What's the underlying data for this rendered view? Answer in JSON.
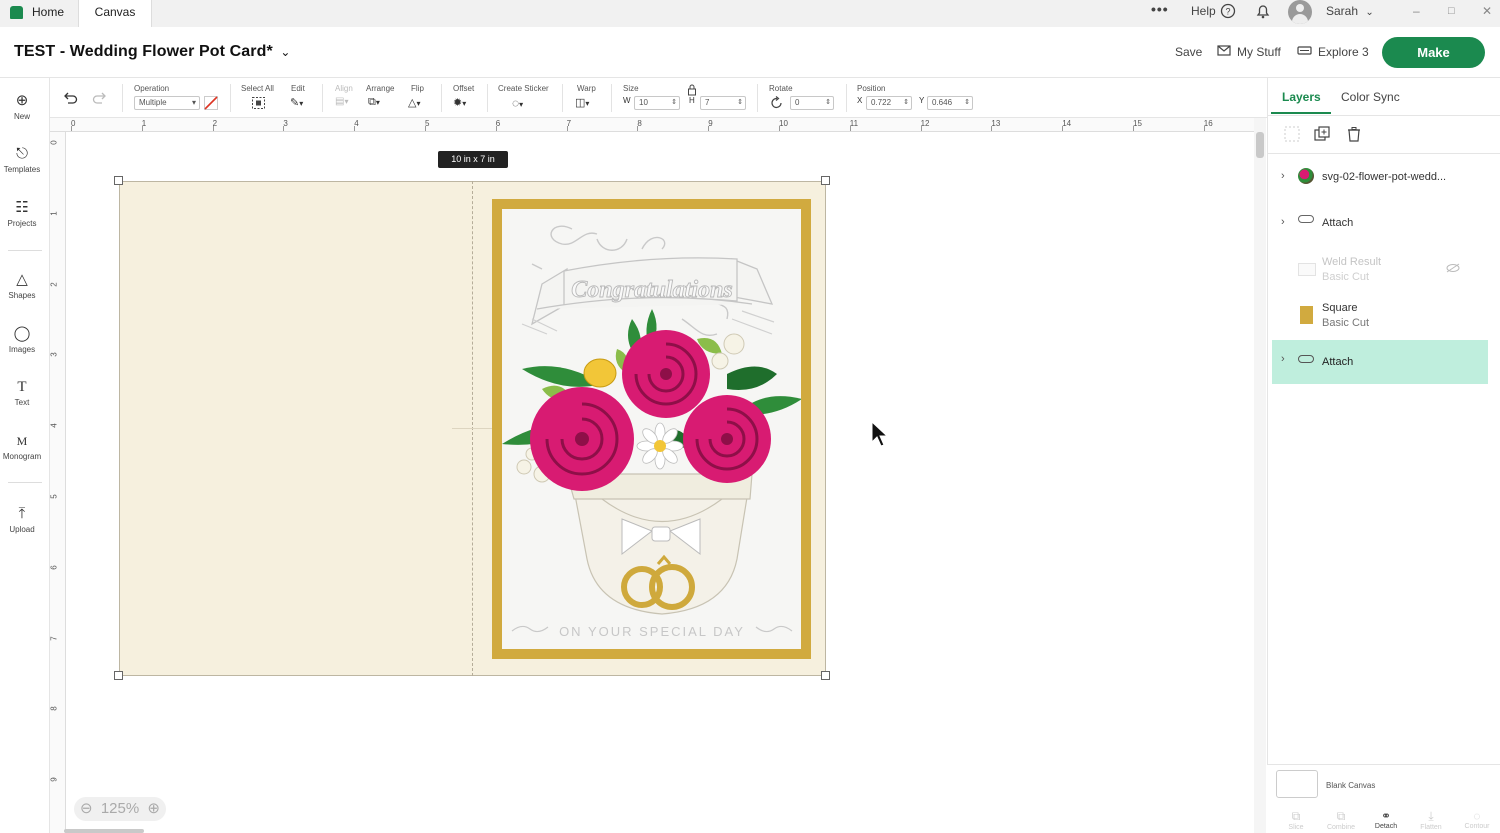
{
  "tabs": {
    "home": "Home",
    "canvas": "Canvas"
  },
  "topbar": {
    "more": "•••",
    "help": "Help",
    "user": "Sarah"
  },
  "header": {
    "title": "TEST - Wedding Flower Pot Card*",
    "save": "Save",
    "my_stuff": "My Stuff",
    "machine": "Explore 3",
    "make": "Make"
  },
  "toolbar": {
    "operation_label": "Operation",
    "operation_value": "Multiple",
    "select_all": "Select All",
    "edit": "Edit",
    "align": "Align",
    "arrange": "Arrange",
    "flip": "Flip",
    "offset": "Offset",
    "create_sticker": "Create Sticker",
    "warp": "Warp",
    "size_label": "Size",
    "w_label": "W",
    "w_value": "10",
    "h_label": "H",
    "h_value": "7",
    "rotate_label": "Rotate",
    "rotate_value": "0",
    "position_label": "Position",
    "x_label": "X",
    "x_value": "0.722",
    "y_label": "Y",
    "y_value": "0.646"
  },
  "sidebar": {
    "items": [
      {
        "label": "New",
        "icon": "plus-circle-icon"
      },
      {
        "label": "Templates",
        "icon": "shirt-icon"
      },
      {
        "label": "Projects",
        "icon": "clipboard-icon"
      },
      {
        "label": "Shapes",
        "icon": "shapes-icon"
      },
      {
        "label": "Images",
        "icon": "lightbulb-icon"
      },
      {
        "label": "Text",
        "icon": "text-icon"
      },
      {
        "label": "Monogram",
        "icon": "monogram-icon"
      },
      {
        "label": "Upload",
        "icon": "upload-icon"
      }
    ]
  },
  "ruler": {
    "h": [
      "0",
      "1",
      "2",
      "3",
      "4",
      "5",
      "6",
      "7",
      "8",
      "9",
      "10",
      "11",
      "12",
      "13",
      "14",
      "15",
      "16"
    ],
    "v": [
      "0",
      "1",
      "2",
      "3",
      "4",
      "5",
      "6",
      "7",
      "8",
      "9"
    ]
  },
  "canvas": {
    "size_tag": "10 in x 7 in",
    "card_title": "Congratulations",
    "card_footer": "ON YOUR SPECIAL DAY",
    "zoom": "125%",
    "colors": {
      "card": "#f6f0de",
      "gold": "#d1aa3f",
      "rose": "#d81b72",
      "leaf": "#2e8b2e"
    }
  },
  "panel": {
    "tab_layers": "Layers",
    "tab_color_sync": "Color Sync",
    "layers": [
      {
        "name": "svg-02-flower-pot-wedd...",
        "sub": ""
      },
      {
        "name": "Attach",
        "sub": ""
      },
      {
        "name": "Weld Result",
        "sub": "Basic Cut"
      },
      {
        "name": "Square",
        "sub": "Basic Cut"
      },
      {
        "name": "Attach",
        "sub": ""
      }
    ],
    "blank_canvas": "Blank Canvas",
    "bottom_tools": [
      "Slice",
      "Combine",
      "Detach",
      "Flatten",
      "Contour"
    ]
  }
}
